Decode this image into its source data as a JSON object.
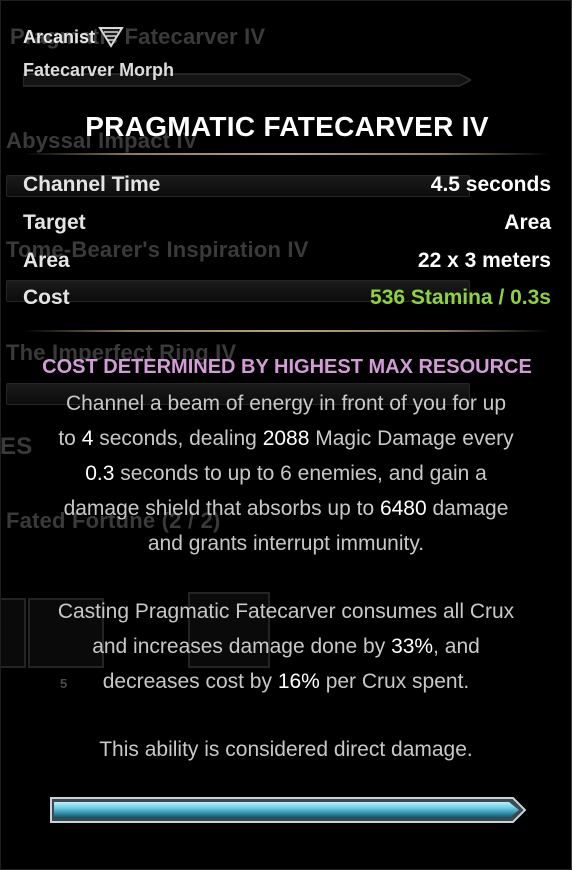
{
  "background": {
    "items": [
      "Pragmatic Fatecarver IV",
      "Abyssal Impact IV",
      "Tome-Bearer's Inspiration IV",
      "The Imperfect Ring IV",
      "ES",
      "Fated Fortune (2 / 2)",
      "5"
    ]
  },
  "header": {
    "class_name": "Arcanist",
    "morph": "Fatecarver Morph",
    "class_icon": "arcanist-emblem-icon"
  },
  "ability": {
    "title": "PRAGMATIC FATECARVER IV"
  },
  "stats": [
    {
      "label": "Channel Time",
      "value": "4.5 seconds"
    },
    {
      "label": "Target",
      "value": "Area"
    },
    {
      "label": "Area",
      "value": "22 x 3 meters"
    },
    {
      "label": "Cost",
      "value": "536 Stamina / 0.3s"
    }
  ],
  "cost_note": "COST DETERMINED BY HIGHEST MAX RESOURCE",
  "description": {
    "p1": [
      {
        "t": "Channel a beam of energy in front of you for up"
      },
      {
        "t": "to "
      },
      {
        "t": "4",
        "n": true
      },
      {
        "t": " seconds, dealing "
      },
      {
        "t": "2088",
        "n": true
      },
      {
        "t": " Magic Damage every"
      },
      {
        "t": "0.3",
        "n": true
      },
      {
        "t": " seconds to up to 6 enemies, and gain a"
      },
      {
        "t": "damage shield that absorbs up to "
      },
      {
        "t": "6480",
        "n": true
      },
      {
        "t": " damage"
      },
      {
        "t": "and grants interrupt immunity."
      }
    ],
    "p2": [
      {
        "t": "Casting Pragmatic Fatecarver consumes all Crux"
      },
      {
        "t": "and increases damage done by "
      },
      {
        "t": "33%",
        "n": true
      },
      {
        "t": ", and"
      },
      {
        "t": "decreases cost by "
      },
      {
        "t": "16%",
        "n": true
      },
      {
        "t": " per Crux spent."
      }
    ],
    "p3": "This ability is considered direct damage."
  },
  "colors": {
    "cost_value": "#8ed23c",
    "cost_note": "#d59ad8",
    "bar_fill": "#5fc4d8"
  },
  "progress": 1.0
}
